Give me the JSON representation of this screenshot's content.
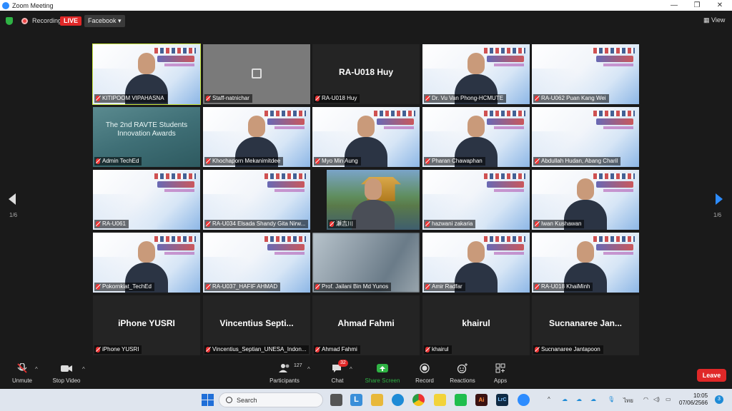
{
  "window": {
    "title": "Zoom Meeting"
  },
  "status": {
    "recording_label": "Recording",
    "live_label": "LIVE",
    "stream_target": "Facebook",
    "view_label": "View"
  },
  "pager": {
    "left": "1/6",
    "right": "1/6"
  },
  "tiles": [
    {
      "name": "KITIPOOM VIPAHASNA",
      "style": "slide-person",
      "big": ""
    },
    {
      "name": "Staff-natnichar",
      "style": "grey",
      "big": ""
    },
    {
      "name": "RA-U018 Huy",
      "style": "dark",
      "big": "RA-U018 Huy"
    },
    {
      "name": "Dr. Vu Van Phong-HCMUTE",
      "style": "slide-person",
      "big": ""
    },
    {
      "name": "RA-U062 Puan Kang Wei",
      "style": "slide",
      "big": ""
    },
    {
      "name": "Admin TechEd",
      "style": "teal",
      "big": "The 2nd RAVTE Students Innovation Awards"
    },
    {
      "name": "Khochaporn Mekanimitdee",
      "style": "slide-person",
      "big": ""
    },
    {
      "name": "Myo Min Aung",
      "style": "slide-person",
      "big": ""
    },
    {
      "name": "Pharan Chawaphan",
      "style": "slide-person",
      "big": ""
    },
    {
      "name": "Abdullah Hudan, Abang Charil",
      "style": "slide",
      "big": ""
    },
    {
      "name": "RA-U061",
      "style": "slide",
      "big": ""
    },
    {
      "name": "RA-U034 Elsada Shandy Gita Nirw...",
      "style": "slide",
      "big": ""
    },
    {
      "name": "瀬吉川",
      "style": "photo",
      "big": ""
    },
    {
      "name": "hazwani zakaria",
      "style": "slide",
      "big": ""
    },
    {
      "name": "Iwan Kushawan",
      "style": "slide-person",
      "big": ""
    },
    {
      "name": "Pokornkiat_TechEd",
      "style": "slide-person",
      "big": ""
    },
    {
      "name": "RA-U037_HAFIF AHMAD",
      "style": "slide",
      "big": ""
    },
    {
      "name": "Prof. Jailani Bin Md Yunos",
      "style": "blur",
      "big": ""
    },
    {
      "name": "Amir Radfar",
      "style": "slide-person",
      "big": ""
    },
    {
      "name": "RA-U018 KhaiMinh",
      "style": "slide-person",
      "big": ""
    },
    {
      "name": "iPhone YUSRI",
      "style": "dark",
      "big": "iPhone YUSRI"
    },
    {
      "name": "Vincentius_Septian_UNESA_Indon...",
      "style": "dark",
      "big": "Vincentius Septi..."
    },
    {
      "name": "Ahmad Fahmi",
      "style": "dark",
      "big": "Ahmad Fahmi"
    },
    {
      "name": "khairul",
      "style": "dark",
      "big": "khairul"
    },
    {
      "name": "Sucnanaree Jantapoon",
      "style": "dark",
      "big": "Sucnanaree Jan..."
    }
  ],
  "toolbar": {
    "unmute": "Unmute",
    "stop_video": "Stop Video",
    "participants": "Participants",
    "participants_count": "127",
    "chat": "Chat",
    "chat_badge": "32",
    "share": "Share Screen",
    "record": "Record",
    "reactions": "Reactions",
    "apps": "Apps",
    "leave": "Leave"
  },
  "taskbar": {
    "search": "Search",
    "lang": "ไทย",
    "time": "10:05",
    "date": "07/06/2566",
    "notif": "3"
  },
  "colors": {
    "accent": "#2d8cff",
    "live": "#e02828",
    "share": "#2fb344",
    "active_border": "#c8e63c"
  }
}
